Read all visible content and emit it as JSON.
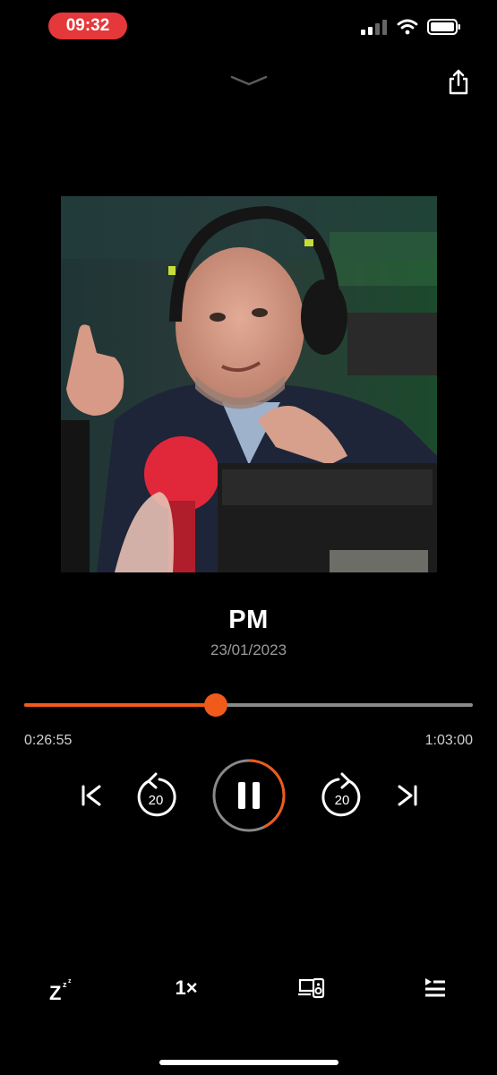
{
  "status_bar": {
    "time": "09:32"
  },
  "episode": {
    "title": "PM",
    "date": "23/01/2023"
  },
  "progress": {
    "elapsed": "0:26:55",
    "total": "1:03:00",
    "fraction": 0.4272
  },
  "controls": {
    "rewind_seconds": "20",
    "forward_seconds": "20",
    "state": "playing"
  },
  "bottom_bar": {
    "speed_label": "1×"
  },
  "colors": {
    "accent": "#f05a1a",
    "status_pill": "#e5383b",
    "background": "#000000",
    "track": "#8a8a8a"
  },
  "icons": [
    "signal-icon",
    "wifi-icon",
    "battery-icon",
    "chevron-down-icon",
    "share-icon",
    "skip-previous-icon",
    "rewind-20-icon",
    "pause-icon",
    "forward-20-icon",
    "skip-next-icon",
    "sleep-timer-icon",
    "cast-icon",
    "queue-icon"
  ]
}
